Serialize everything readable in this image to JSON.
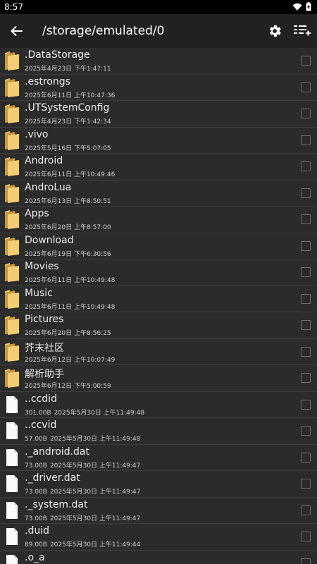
{
  "status_bar": {
    "time": "8:57"
  },
  "toolbar": {
    "path": "/storage/emulated/0"
  },
  "files": [
    {
      "type": "folder",
      "name": ".DataStorage",
      "date": "2025年4月23日 下午1:47:11"
    },
    {
      "type": "folder",
      "name": ".estrongs",
      "date": "2025年6月11日 上午10:47:36"
    },
    {
      "type": "folder",
      "name": ".UTSystemConfig",
      "date": "2025年4月23日 下午1:42:34"
    },
    {
      "type": "folder",
      "name": ".vivo",
      "date": "2025年5月16日 下午5:07:05"
    },
    {
      "type": "folder",
      "name": "Android",
      "date": "2025年6月11日 上午10:49:46"
    },
    {
      "type": "folder",
      "name": "AndroLua",
      "date": "2025年6月13日 上午8:50:51"
    },
    {
      "type": "folder",
      "name": "Apps",
      "date": "2025年6月20日 上午8:57:00"
    },
    {
      "type": "folder",
      "name": "Download",
      "date": "2025年6月19日 下午6:30:56"
    },
    {
      "type": "folder",
      "name": "Movies",
      "date": "2025年6月11日 上午10:49:48"
    },
    {
      "type": "folder",
      "name": "Music",
      "date": "2025年6月11日 上午10:49:48"
    },
    {
      "type": "folder",
      "name": "Pictures",
      "date": "2025年6月20日 上午8:56:25"
    },
    {
      "type": "folder",
      "name": "芥末社区",
      "date": "2025年6月12日 上午10:07:49"
    },
    {
      "type": "folder",
      "name": "解析助手",
      "date": "2025年6月12日 下午5:00:59"
    },
    {
      "type": "file",
      "name": "..ccdid",
      "size": "301.00B",
      "date": "2025年5月30日 上午11:49:48"
    },
    {
      "type": "file",
      "name": "..ccvid",
      "size": "57.00B",
      "date": "2025年5月30日 上午11:49:48"
    },
    {
      "type": "file",
      "name": "._android.dat",
      "size": "73.00B",
      "date": "2025年5月30日 上午11:49:47"
    },
    {
      "type": "file",
      "name": "._driver.dat",
      "size": "73.00B",
      "date": "2025年5月30日 上午11:49:47"
    },
    {
      "type": "file",
      "name": "._system.dat",
      "size": "73.00B",
      "date": "2025年5月30日 上午11:49:47"
    },
    {
      "type": "file",
      "name": ".duid",
      "size": "89.00B",
      "date": "2025年5月30日 上午11:49:44"
    },
    {
      "type": "file",
      "name": ".o_a",
      "size": "",
      "date": ""
    }
  ]
}
